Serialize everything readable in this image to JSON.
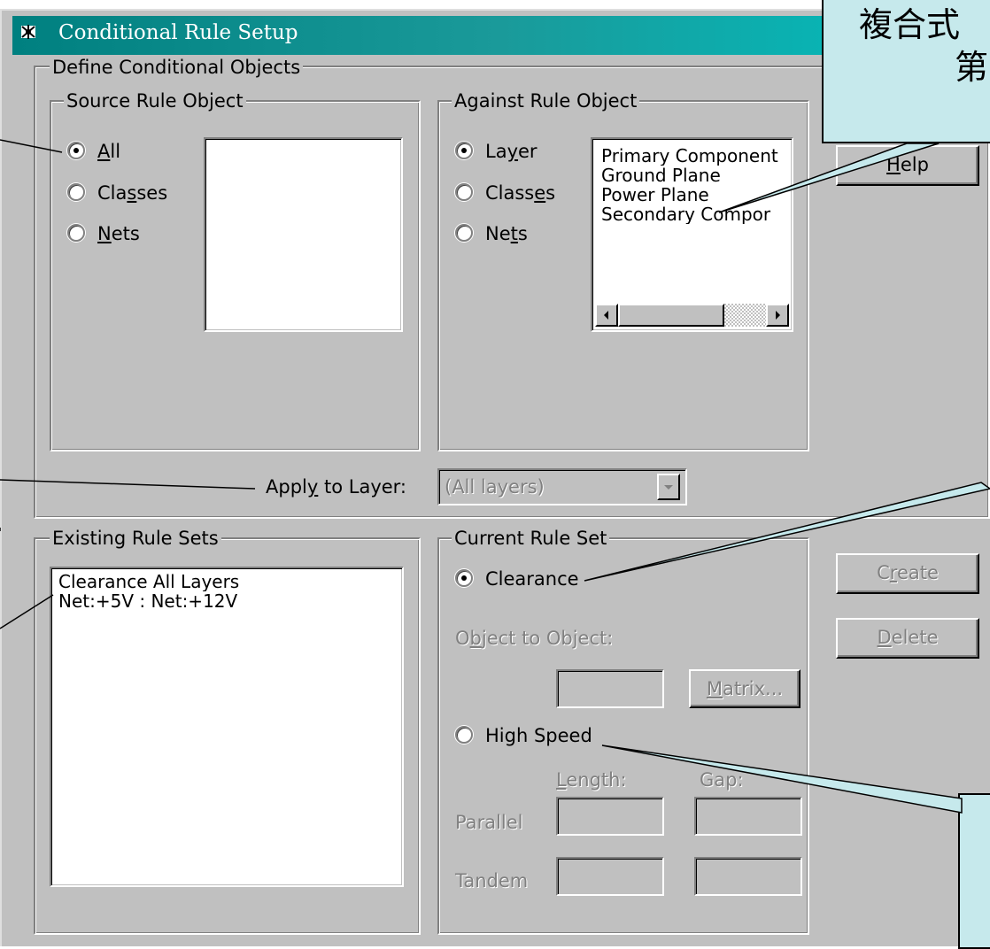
{
  "window": {
    "title": "Conditional Rule Setup"
  },
  "define_group": {
    "label": "Define Conditional Objects"
  },
  "source_rule_object": {
    "label": "Source Rule Object",
    "options": [
      {
        "pre": "",
        "key": "A",
        "post": "ll",
        "selected": true
      },
      {
        "pre": "Cla",
        "key": "s",
        "post": "ses",
        "selected": false
      },
      {
        "pre": "",
        "key": "N",
        "post": "ets",
        "selected": false
      }
    ]
  },
  "against_rule_object": {
    "label": "Against Rule Object",
    "options": [
      {
        "pre": "La",
        "key": "y",
        "post": "er",
        "selected": true
      },
      {
        "pre": "Class",
        "key": "e",
        "post": "s",
        "selected": false
      },
      {
        "pre": "Ne",
        "key": "t",
        "post": "s",
        "selected": false
      }
    ],
    "list_items": [
      "Primary Component",
      "Ground Plane",
      "Power Plane",
      "Secondary Compor"
    ]
  },
  "apply_to_layer": {
    "pre": "Appl",
    "key": "y",
    "post": " to Layer:",
    "value": "(All layers)"
  },
  "existing_rule_sets": {
    "label": "Existing Rule Sets",
    "items": [
      "Clearance All Layers",
      "Net:+5V : Net:+12V"
    ]
  },
  "current_rule_set": {
    "label": "Current Rule Set",
    "clearance_label": "Clearance",
    "object_to_object": {
      "pre": "O",
      "key": "b",
      "post": "ject to Object:"
    },
    "matrix_button": {
      "key": "M",
      "post": "atrix..."
    },
    "high_speed_label": "High Speed",
    "length_label": {
      "key": "L",
      "post": "ength:"
    },
    "gap_label": "Gap:",
    "parallel_label": "Parallel",
    "tandem_label": "Tandem"
  },
  "buttons": {
    "help": {
      "key": "H",
      "post": "elp"
    },
    "create": {
      "pre": "C",
      "key": "r",
      "post": "eate"
    },
    "delete": {
      "pre": "",
      "key": "D",
      "post": "elete"
    }
  },
  "callout": {
    "line1": "複合式",
    "line2": "第"
  },
  "colors": {
    "title_start": "#008080",
    "title_end": "#00c0c0",
    "callout_bg": "#c6e9ec",
    "face": "#c0c0c0"
  }
}
